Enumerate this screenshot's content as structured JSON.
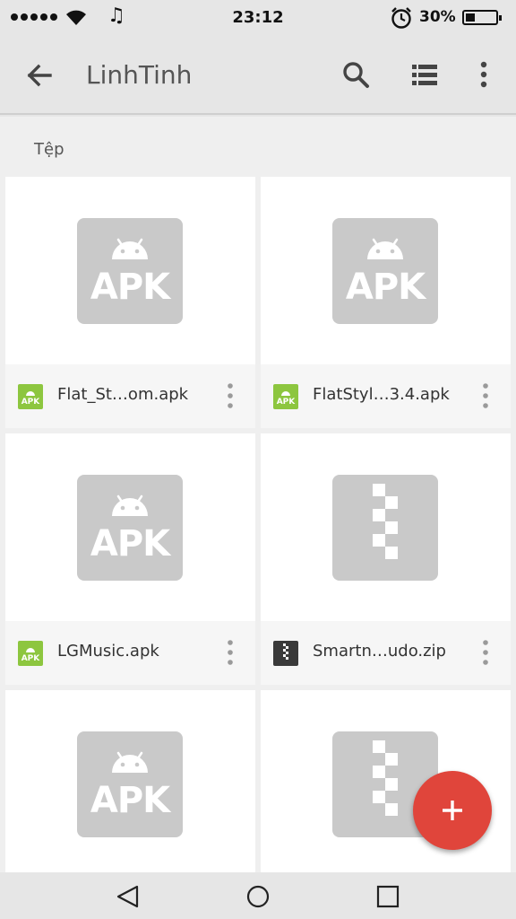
{
  "status_bar": {
    "time": "23:12",
    "battery_text": "30%",
    "battery_level": 0.3,
    "icons": [
      "signal-dots-icon",
      "wifi-icon",
      "music-note-icon",
      "alarm-icon",
      "battery-icon"
    ],
    "music_glyph": "♫"
  },
  "app_bar": {
    "title": "LinhTinh",
    "icons": [
      "back-arrow-icon",
      "search-icon",
      "list-view-icon",
      "more-vert-icon"
    ]
  },
  "section": {
    "label": "Tệp"
  },
  "files": [
    {
      "name": "Flat_St…om.apk",
      "type": "apk",
      "thumb_label": "APK"
    },
    {
      "name": "FlatStyl…3.4.apk",
      "type": "apk",
      "thumb_label": "APK"
    },
    {
      "name": "LGMusic.apk",
      "type": "apk",
      "thumb_label": "APK"
    },
    {
      "name": "Smartn…udo.zip",
      "type": "zip",
      "thumb_label": ""
    },
    {
      "name": "",
      "type": "apk",
      "thumb_label": "APK"
    },
    {
      "name": "",
      "type": "zip",
      "thumb_label": ""
    }
  ],
  "mini_apk_label": "APK",
  "fab": {
    "icon": "add-icon",
    "color": "#e0453b"
  },
  "nav_bar": {
    "icons": [
      "nav-back-icon",
      "nav-home-icon",
      "nav-recents-icon"
    ]
  },
  "colors": {
    "apk_green": "#8dc63f",
    "thumb_gray": "#c9c9c9",
    "zip_dark": "#3a3a3a"
  }
}
